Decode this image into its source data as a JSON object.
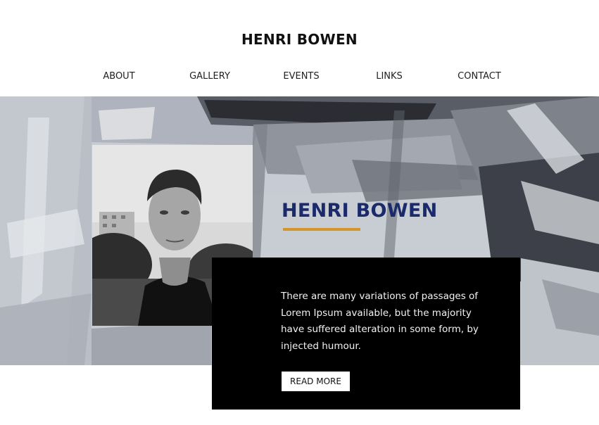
{
  "header": {
    "site_title": "HENRI BOWEN",
    "nav": [
      {
        "label": "ABOUT"
      },
      {
        "label": "GALLERY"
      },
      {
        "label": "EVENTS"
      },
      {
        "label": "LINKS"
      },
      {
        "label": "CONTACT"
      }
    ]
  },
  "hero": {
    "background": "abstract-painted-texture",
    "portrait": "portrait-photo",
    "name": "HENRI BOWEN",
    "accent_color": "#d4962a",
    "name_color": "#1b2a6b",
    "bio": "There are many variations of passages of Lorem Ipsum available, but the majority have suffered alteration in some form, by injected humour.",
    "read_more_label": "READ MORE"
  }
}
